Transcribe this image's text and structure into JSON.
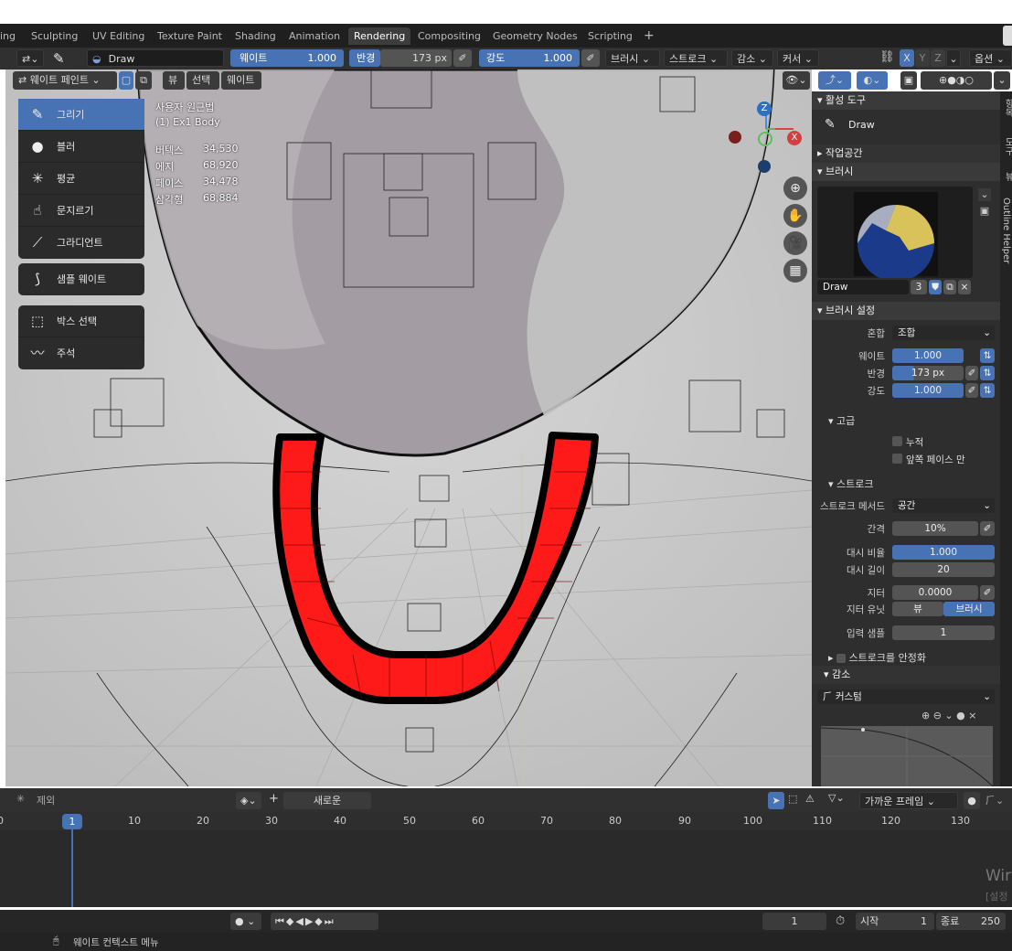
{
  "workspace_tabs": [
    "ing",
    "Sculpting",
    "UV Editing",
    "Texture Paint",
    "Shading",
    "Animation",
    "Rendering",
    "Compositing",
    "Geometry Nodes",
    "Scripting",
    "+"
  ],
  "active_tab": "Rendering",
  "header": {
    "brush_name": "Draw",
    "weight_label": "웨이트",
    "weight_value": "1.000",
    "radius_label": "반경",
    "radius_value": "173 px",
    "strength_label": "강도",
    "strength_value": "1.000",
    "brush_menu": "브러시",
    "stroke_menu": "스트로크",
    "falloff_menu": "감소",
    "cursor_menu": "커서",
    "mirror_x": "X",
    "mirror_y": "Y",
    "mirror_z": "Z",
    "options_menu": "옵션"
  },
  "viewport_header": {
    "mode": "웨이트 페인트",
    "view_menu": "뷰",
    "select_menu": "선택",
    "weights_menu": "웨이트"
  },
  "tools": [
    {
      "label": "그리기",
      "icon": "brush-icon",
      "active": true
    },
    {
      "label": "블러",
      "icon": "drop-icon",
      "active": false
    },
    {
      "label": "평균",
      "icon": "average-icon",
      "active": false
    },
    {
      "label": "문지르기",
      "icon": "smear-icon",
      "active": false
    },
    {
      "label": "그라디언트",
      "icon": "gradient-icon",
      "active": false
    }
  ],
  "tool_sample": "샘플 웨이트",
  "tool_box_select": "박스 선택",
  "tool_annotate": "주석",
  "stats": {
    "view": "사용자 원근법",
    "object": "(1) Ex1 Body",
    "rows": [
      {
        "label": "버텍스",
        "value": "34,530"
      },
      {
        "label": "에지",
        "value": "68,920"
      },
      {
        "label": "페이스",
        "value": "34,478"
      },
      {
        "label": "삼각형",
        "value": "68,884"
      }
    ]
  },
  "gizmo": {
    "x": "X",
    "y": "Y",
    "z": "Z"
  },
  "npanel": {
    "active_tool_header": "활성 도구",
    "active_tool_name": "Draw",
    "workspace_header": "작업공간",
    "brushes_header": "브러시",
    "brush_name": "Draw",
    "brush_users": "3",
    "brush_settings_header": "브러시 설정",
    "blend_label": "혼합",
    "blend_value": "조합",
    "weight_label": "웨이트",
    "weight_value": "1.000",
    "radius_label": "반경",
    "radius_value": "173 px",
    "strength_label": "강도",
    "strength_value": "1.000",
    "advanced_header": "고급",
    "accumulate_label": "누적",
    "front_faces_label": "앞쪽 페이스 만",
    "stroke_header": "스트로크",
    "stroke_method_label": "스트로크 메서드",
    "stroke_method_value": "공간",
    "spacing_label": "간격",
    "spacing_value": "10%",
    "dash_ratio_label": "대시 비율",
    "dash_ratio_value": "1.000",
    "dash_length_label": "대시 길이",
    "dash_length_value": "20",
    "jitter_label": "지터",
    "jitter_value": "0.0000",
    "jitter_unit_label": "지터 유닛",
    "jitter_unit_view": "뷰",
    "jitter_unit_brush": "브러시",
    "input_samples_label": "입력 샘플",
    "input_samples_value": "1",
    "stabilize_label": "스트로크를 안정화",
    "falloff_header": "감소",
    "falloff_preset": "커스텀"
  },
  "side_tabs": [
    "항목",
    "도구",
    "뷰",
    "Outline Helper"
  ],
  "timeline": {
    "exclude_label": "제외",
    "new_label": "새로운",
    "snap_label": "가까운 프레임",
    "ticks": [
      "0",
      "1",
      "10",
      "20",
      "30",
      "40",
      "50",
      "60",
      "70",
      "80",
      "90",
      "100",
      "110",
      "120",
      "130"
    ],
    "current_frame": "1",
    "start_label": "시작",
    "start_value": "1",
    "end_label": "종료",
    "end_value": "250",
    "watermark": "Wir",
    "watermark2": "[설정"
  },
  "status": {
    "context_menu": "웨이트 컨텍스트 메뉴"
  },
  "colors": {
    "accent": "#4772b3",
    "red_weight": "#ff1a1a",
    "panel": "#2e2e2e",
    "header": "#303030"
  }
}
